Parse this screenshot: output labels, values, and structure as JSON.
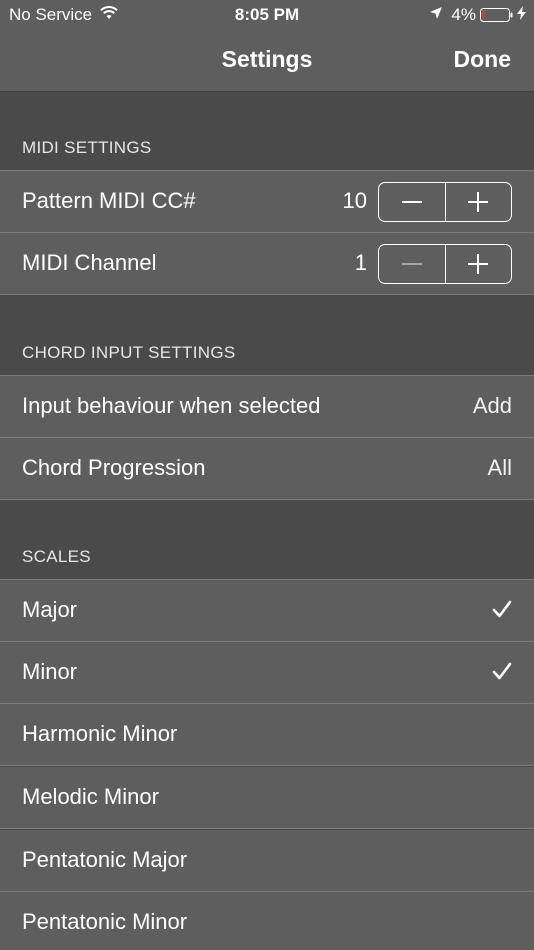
{
  "status_bar": {
    "carrier": "No Service",
    "time": "8:05 PM",
    "battery_percent": "4%",
    "icons": [
      "wifi-icon",
      "location-arrow-icon",
      "battery-icon",
      "charging-bolt-icon"
    ]
  },
  "nav": {
    "title": "Settings",
    "done_label": "Done"
  },
  "midi_settings": {
    "header": "MIDI SETTINGS",
    "pattern_cc": {
      "label": "Pattern MIDI CC#",
      "value": "10"
    },
    "channel": {
      "label": "MIDI Channel",
      "value": "1"
    }
  },
  "chord_input": {
    "header": "CHORD INPUT SETTINGS",
    "behaviour": {
      "label": "Input behaviour when selected",
      "value": "Add"
    },
    "progression": {
      "label": "Chord Progression",
      "value": "All"
    }
  },
  "scales": {
    "header": "SCALES",
    "items": [
      {
        "label": "Major",
        "checked": true
      },
      {
        "label": "Minor",
        "checked": true
      },
      {
        "label": "Harmonic Minor",
        "checked": false
      },
      {
        "label": "Melodic Minor",
        "checked": false
      },
      {
        "label": "Pentatonic Major",
        "checked": false
      },
      {
        "label": "Pentatonic Minor",
        "checked": false
      }
    ]
  },
  "colors": {
    "background": "#4a4a4a",
    "cell": "#5e5e5e",
    "separator": "#7c7c7c",
    "text": "#ffffff"
  }
}
